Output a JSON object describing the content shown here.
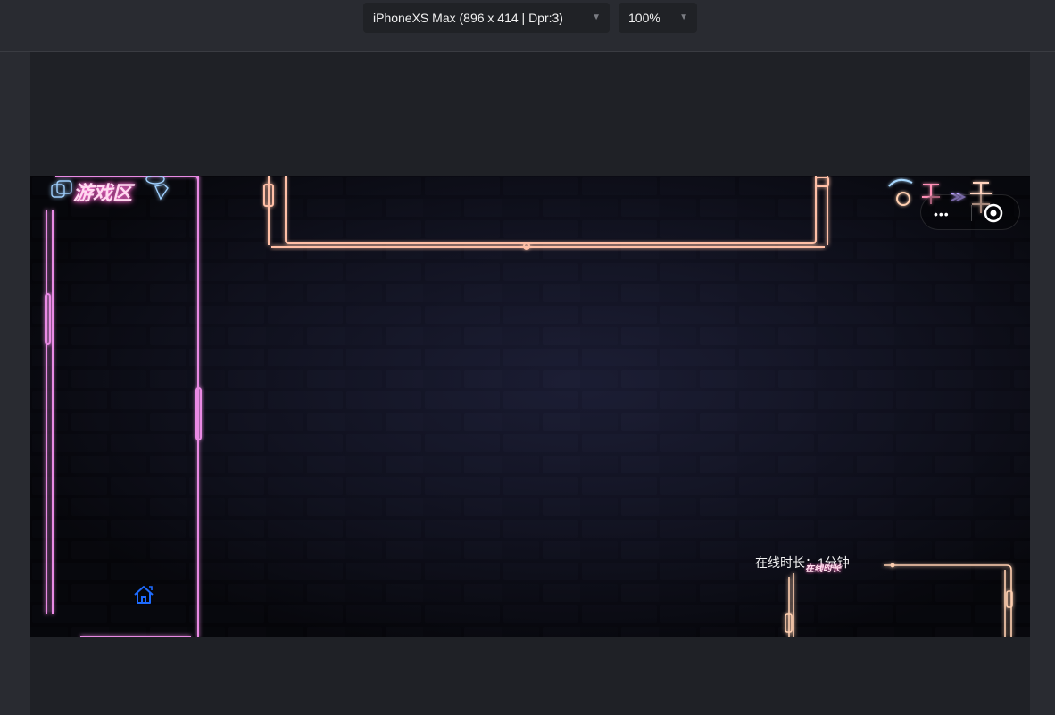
{
  "devtools": {
    "device_label": "iPhoneXS Max (896 x 414 | Dpr:3)",
    "zoom_label": "100%"
  },
  "game": {
    "game_area_label": "游戏区",
    "online_time_label": "在线时长：1分钟",
    "online_badge_label": "在线时长",
    "capsule_dots": "•••"
  },
  "colors": {
    "neon_pink": "#e66fe0",
    "neon_orange": "#ffb08a",
    "neon_peach": "#ffcfb0",
    "home_blue": "#1e6bff"
  },
  "icons": [
    "chevron-down-icon",
    "home-icon",
    "more-dots-icon",
    "target-icon"
  ]
}
